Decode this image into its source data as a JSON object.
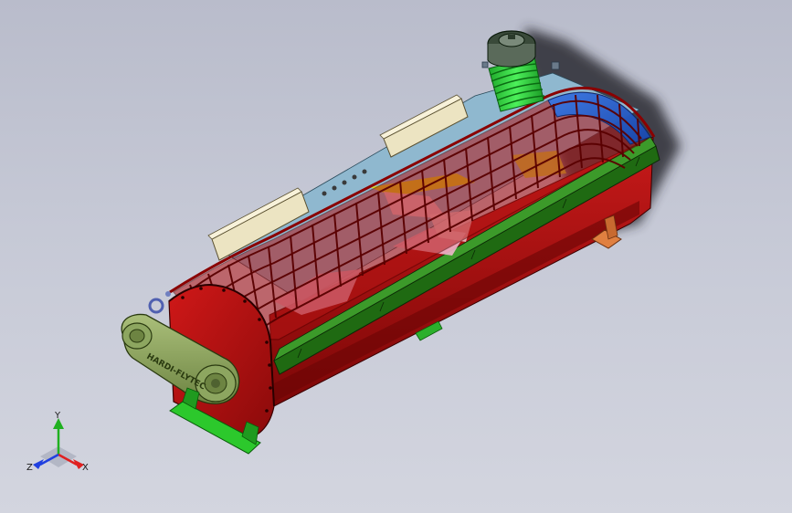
{
  "viewport": {
    "background_top": "#b9bccb",
    "background_bottom": "#d3d5df"
  },
  "model": {
    "nameplate_text": "HARDI-FLYTEC",
    "colors": {
      "body": "#b40f0f",
      "grid": "#c81e1e",
      "grid_blue": "#1f5fd0",
      "side_rail": "#1f6a12",
      "chain_guard": "#8aa05a",
      "vent_hose": "#29d23a",
      "base_foot": "#2cc82c",
      "cover_panel": "#ece4c2"
    }
  },
  "triad": {
    "x_label": "X",
    "y_label": "Y",
    "z_label": "Z",
    "x_color": "#e02020",
    "y_color": "#20b020",
    "z_color": "#2040e0"
  }
}
